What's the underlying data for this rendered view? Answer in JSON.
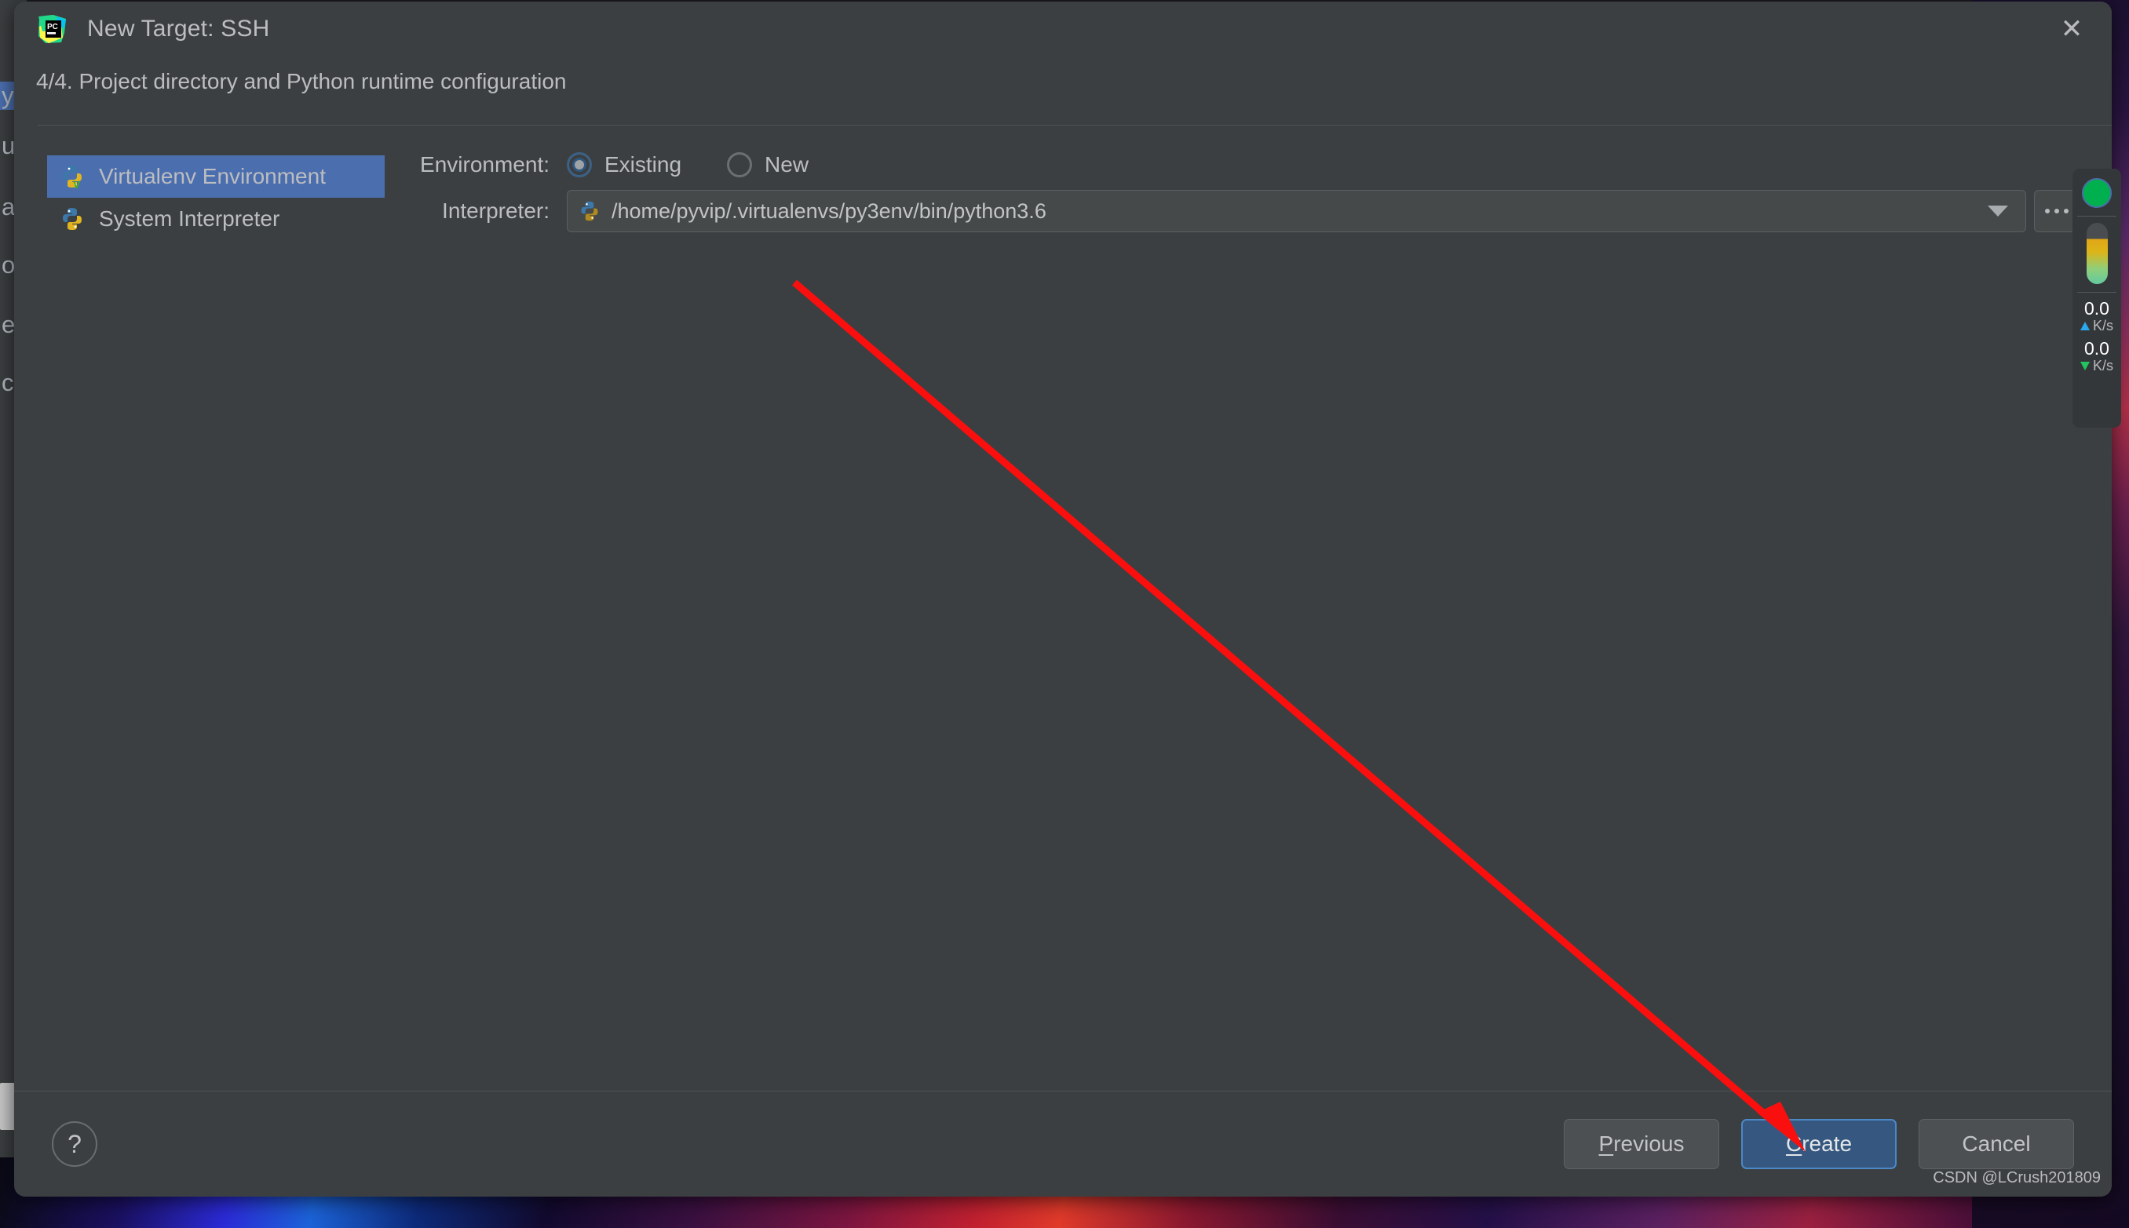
{
  "window": {
    "title": "New Target: SSH",
    "app_icon": "pycharm-icon",
    "close_label": "✕"
  },
  "step": {
    "text": "4/4. Project directory and Python runtime configuration"
  },
  "environment_types": [
    {
      "label": "Virtualenv Environment",
      "icon": "python-virtualenv-icon",
      "selected": true
    },
    {
      "label": "System Interpreter",
      "icon": "python-icon",
      "selected": false
    }
  ],
  "form": {
    "environment_label": "Environment:",
    "environment_options": [
      {
        "label": "Existing",
        "checked": true
      },
      {
        "label": "New",
        "checked": false
      }
    ],
    "interpreter_label": "Interpreter:",
    "interpreter_value": "/home/pyvip/.virtualenvs/py3env/bin/python3.6",
    "interpreter_icon": "python-icon",
    "dropdown_icon": "chevron-down-icon",
    "browse_label": "...",
    "browse_icon": "ellipsis-icon"
  },
  "footer": {
    "help_label": "?",
    "previous_label": "Previous",
    "previous_mnemonic": "P",
    "create_label": "Create",
    "create_mnemonic": "C",
    "cancel_label": "Cancel"
  },
  "netmon": {
    "status_icon": "green-status-dot",
    "upload_value": "0.0",
    "upload_unit": "K/s",
    "download_value": "0.0",
    "download_unit": "K/s"
  },
  "background": {
    "ghost_letters": [
      "y",
      "u",
      "a",
      "o",
      "e",
      "c"
    ],
    "watermark": "CSDN @LCrush201809"
  },
  "colors": {
    "dialog_bg": "#3c3f41",
    "accent_blue": "#4b6eaf",
    "primary_button": "#365880",
    "annotation_red": "#fa0f0f",
    "status_green": "#00b04f"
  }
}
